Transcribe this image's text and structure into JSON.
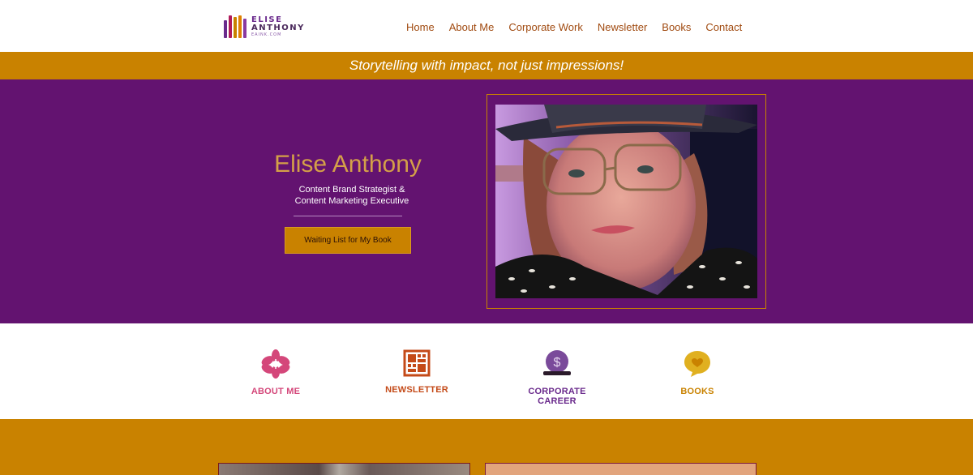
{
  "logo": {
    "line1": "ELISE",
    "line2": "ANTHONY",
    "line3": "EAINK.COM",
    "bar_colors": [
      "#6a2a8c",
      "#b01a5a",
      "#c98200",
      "#e08000",
      "#8a3aa0"
    ]
  },
  "nav": {
    "items": [
      "Home",
      "About Me",
      "Corporate Work",
      "Newsletter",
      "Books",
      "Contact"
    ]
  },
  "tagline": "Storytelling with impact, not just impressions!",
  "hero": {
    "name": "Elise Anthony",
    "subtitle_line1": "Content Brand Strategist &",
    "subtitle_line2": "Content Marketing Executive",
    "button_label": "Waiting List for My Book"
  },
  "features": [
    {
      "label": "ABOUT ME",
      "icon": "flower-icon",
      "color": "#d4477a"
    },
    {
      "label": "NEWSLETTER",
      "icon": "newspaper-icon",
      "color": "#c44a18"
    },
    {
      "label": "CORPORATE CAREER",
      "icon": "dollar-coin-icon",
      "color": "#6a2a8c"
    },
    {
      "label": "BOOKS",
      "icon": "heart-chat-icon",
      "color": "#c98200"
    }
  ],
  "colors": {
    "accent_gold": "#c98200",
    "hero_purple": "#631370",
    "nav_text": "#a04a10"
  }
}
